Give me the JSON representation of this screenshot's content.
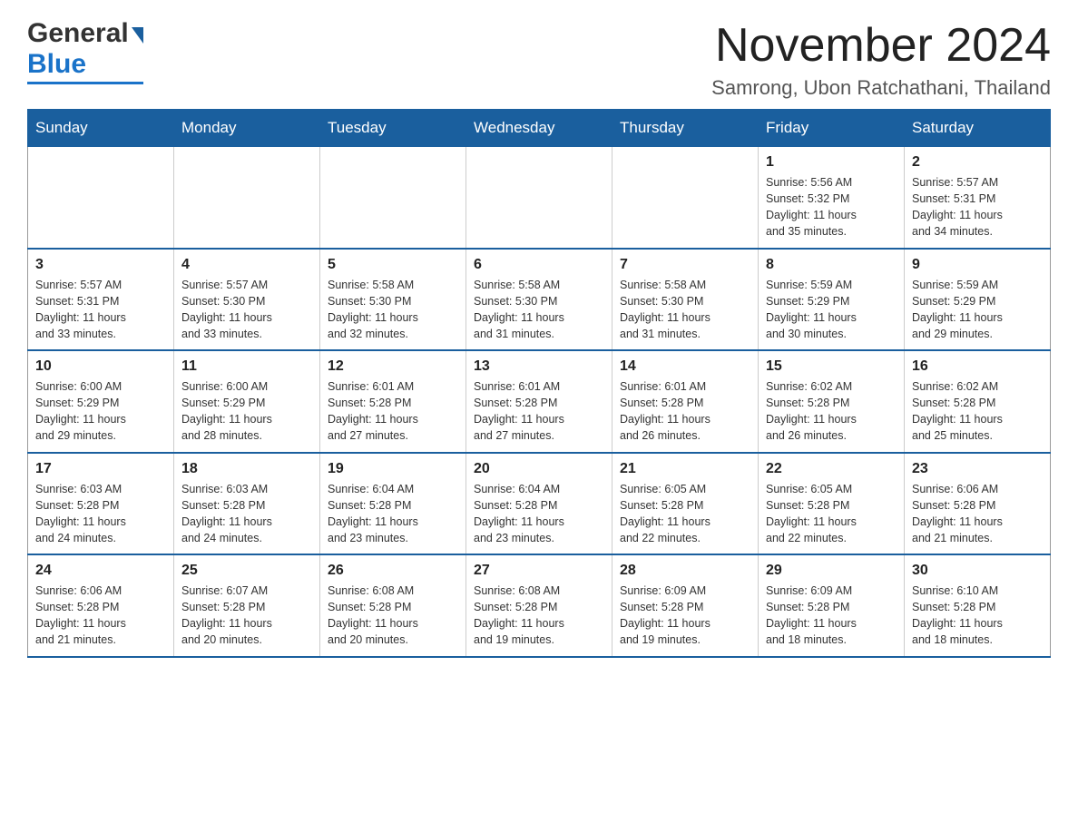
{
  "header": {
    "logo_general": "General",
    "logo_blue": "Blue",
    "main_title": "November 2024",
    "subtitle": "Samrong, Ubon Ratchathani, Thailand"
  },
  "calendar": {
    "days_of_week": [
      "Sunday",
      "Monday",
      "Tuesday",
      "Wednesday",
      "Thursday",
      "Friday",
      "Saturday"
    ],
    "weeks": [
      [
        {
          "day": "",
          "info": ""
        },
        {
          "day": "",
          "info": ""
        },
        {
          "day": "",
          "info": ""
        },
        {
          "day": "",
          "info": ""
        },
        {
          "day": "",
          "info": ""
        },
        {
          "day": "1",
          "info": "Sunrise: 5:56 AM\nSunset: 5:32 PM\nDaylight: 11 hours\nand 35 minutes."
        },
        {
          "day": "2",
          "info": "Sunrise: 5:57 AM\nSunset: 5:31 PM\nDaylight: 11 hours\nand 34 minutes."
        }
      ],
      [
        {
          "day": "3",
          "info": "Sunrise: 5:57 AM\nSunset: 5:31 PM\nDaylight: 11 hours\nand 33 minutes."
        },
        {
          "day": "4",
          "info": "Sunrise: 5:57 AM\nSunset: 5:30 PM\nDaylight: 11 hours\nand 33 minutes."
        },
        {
          "day": "5",
          "info": "Sunrise: 5:58 AM\nSunset: 5:30 PM\nDaylight: 11 hours\nand 32 minutes."
        },
        {
          "day": "6",
          "info": "Sunrise: 5:58 AM\nSunset: 5:30 PM\nDaylight: 11 hours\nand 31 minutes."
        },
        {
          "day": "7",
          "info": "Sunrise: 5:58 AM\nSunset: 5:30 PM\nDaylight: 11 hours\nand 31 minutes."
        },
        {
          "day": "8",
          "info": "Sunrise: 5:59 AM\nSunset: 5:29 PM\nDaylight: 11 hours\nand 30 minutes."
        },
        {
          "day": "9",
          "info": "Sunrise: 5:59 AM\nSunset: 5:29 PM\nDaylight: 11 hours\nand 29 minutes."
        }
      ],
      [
        {
          "day": "10",
          "info": "Sunrise: 6:00 AM\nSunset: 5:29 PM\nDaylight: 11 hours\nand 29 minutes."
        },
        {
          "day": "11",
          "info": "Sunrise: 6:00 AM\nSunset: 5:29 PM\nDaylight: 11 hours\nand 28 minutes."
        },
        {
          "day": "12",
          "info": "Sunrise: 6:01 AM\nSunset: 5:28 PM\nDaylight: 11 hours\nand 27 minutes."
        },
        {
          "day": "13",
          "info": "Sunrise: 6:01 AM\nSunset: 5:28 PM\nDaylight: 11 hours\nand 27 minutes."
        },
        {
          "day": "14",
          "info": "Sunrise: 6:01 AM\nSunset: 5:28 PM\nDaylight: 11 hours\nand 26 minutes."
        },
        {
          "day": "15",
          "info": "Sunrise: 6:02 AM\nSunset: 5:28 PM\nDaylight: 11 hours\nand 26 minutes."
        },
        {
          "day": "16",
          "info": "Sunrise: 6:02 AM\nSunset: 5:28 PM\nDaylight: 11 hours\nand 25 minutes."
        }
      ],
      [
        {
          "day": "17",
          "info": "Sunrise: 6:03 AM\nSunset: 5:28 PM\nDaylight: 11 hours\nand 24 minutes."
        },
        {
          "day": "18",
          "info": "Sunrise: 6:03 AM\nSunset: 5:28 PM\nDaylight: 11 hours\nand 24 minutes."
        },
        {
          "day": "19",
          "info": "Sunrise: 6:04 AM\nSunset: 5:28 PM\nDaylight: 11 hours\nand 23 minutes."
        },
        {
          "day": "20",
          "info": "Sunrise: 6:04 AM\nSunset: 5:28 PM\nDaylight: 11 hours\nand 23 minutes."
        },
        {
          "day": "21",
          "info": "Sunrise: 6:05 AM\nSunset: 5:28 PM\nDaylight: 11 hours\nand 22 minutes."
        },
        {
          "day": "22",
          "info": "Sunrise: 6:05 AM\nSunset: 5:28 PM\nDaylight: 11 hours\nand 22 minutes."
        },
        {
          "day": "23",
          "info": "Sunrise: 6:06 AM\nSunset: 5:28 PM\nDaylight: 11 hours\nand 21 minutes."
        }
      ],
      [
        {
          "day": "24",
          "info": "Sunrise: 6:06 AM\nSunset: 5:28 PM\nDaylight: 11 hours\nand 21 minutes."
        },
        {
          "day": "25",
          "info": "Sunrise: 6:07 AM\nSunset: 5:28 PM\nDaylight: 11 hours\nand 20 minutes."
        },
        {
          "day": "26",
          "info": "Sunrise: 6:08 AM\nSunset: 5:28 PM\nDaylight: 11 hours\nand 20 minutes."
        },
        {
          "day": "27",
          "info": "Sunrise: 6:08 AM\nSunset: 5:28 PM\nDaylight: 11 hours\nand 19 minutes."
        },
        {
          "day": "28",
          "info": "Sunrise: 6:09 AM\nSunset: 5:28 PM\nDaylight: 11 hours\nand 19 minutes."
        },
        {
          "day": "29",
          "info": "Sunrise: 6:09 AM\nSunset: 5:28 PM\nDaylight: 11 hours\nand 18 minutes."
        },
        {
          "day": "30",
          "info": "Sunrise: 6:10 AM\nSunset: 5:28 PM\nDaylight: 11 hours\nand 18 minutes."
        }
      ]
    ]
  }
}
